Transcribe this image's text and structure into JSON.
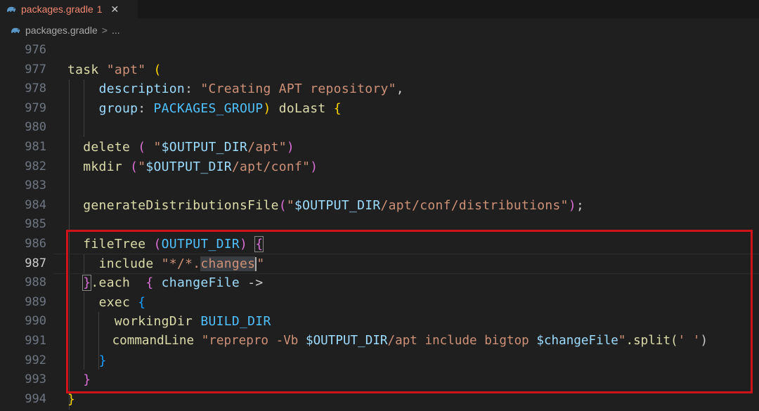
{
  "tab": {
    "filename": "packages.gradle",
    "problem_count": "1",
    "close_glyph": "✕",
    "icon": "gradle-elephant-icon"
  },
  "breadcrumb": {
    "file": "packages.gradle",
    "separator": ">",
    "more": "..."
  },
  "editor": {
    "current_line": "987",
    "lines": [
      {
        "num": "976"
      },
      {
        "num": "977"
      },
      {
        "num": "978"
      },
      {
        "num": "979"
      },
      {
        "num": "980"
      },
      {
        "num": "981"
      },
      {
        "num": "982"
      },
      {
        "num": "983"
      },
      {
        "num": "984"
      },
      {
        "num": "985"
      },
      {
        "num": "986"
      },
      {
        "num": "987"
      },
      {
        "num": "988"
      },
      {
        "num": "989"
      },
      {
        "num": "990"
      },
      {
        "num": "991"
      },
      {
        "num": "992"
      },
      {
        "num": "993"
      },
      {
        "num": "994"
      }
    ],
    "tokens": {
      "l977_task": "task",
      "l977_name": "\"apt\"",
      "l977_paren": "(",
      "l978_key": "description",
      "l978_colon": ":",
      "l978_val": "\"Creating APT repository\"",
      "l978_comma": ",",
      "l979_key": "group",
      "l979_colon": ":",
      "l979_val": "PACKAGES_GROUP",
      "l979_close": ")",
      "l979_dolast": "doLast",
      "l979_brace": "{",
      "l981_fn": "delete",
      "l981_open": "(",
      "l981_q1": "\"",
      "l981_var": "$OUTPUT_DIR",
      "l981_rest": "/apt\"",
      "l981_close": ")",
      "l982_fn": "mkdir",
      "l982_open": "(",
      "l982_q1": "\"",
      "l982_var": "$OUTPUT_DIR",
      "l982_rest": "/apt/conf\"",
      "l982_close": ")",
      "l984_fn": "generateDistributionsFile",
      "l984_open": "(",
      "l984_q1": "\"",
      "l984_var": "$OUTPUT_DIR",
      "l984_rest": "/apt/conf/distributions\"",
      "l984_close": ")",
      "l984_semi": ";",
      "l986_fn": "fileTree",
      "l986_open": "(",
      "l986_arg": "OUTPUT_DIR",
      "l986_close": ")",
      "l986_brace": "{",
      "l987_fn": "include",
      "l987_s1": "\"*/*.",
      "l987_sel": "changes",
      "l987_s2": "\"",
      "l988_close": "}",
      "l988_each": ".each",
      "l988_brace": "{",
      "l988_param": "changeFile",
      "l988_arrow": "->",
      "l989_fn": "exec",
      "l989_brace": "{",
      "l990_fn": "workingDir",
      "l990_arg": "BUILD_DIR",
      "l991_fn": "commandLine",
      "l991_s1": "\"reprepro -Vb ",
      "l991_var1": "$OUTPUT_DIR",
      "l991_s2": "/apt include bigtop ",
      "l991_var2": "$changeFile",
      "l991_s3": "\"",
      "l991_split": ".split(",
      "l991_s4": "' '",
      "l991_close": ")",
      "l992_close": "}",
      "l993_close": "}",
      "l994_close": "}"
    }
  },
  "colors": {
    "background": "#1f1f1f",
    "tab_error": "#f48771",
    "highlight_box": "#d0121b",
    "string": "#ce9178",
    "function": "#dcdcaa",
    "property": "#9cdcfe",
    "constant": "#4fc1ff"
  }
}
